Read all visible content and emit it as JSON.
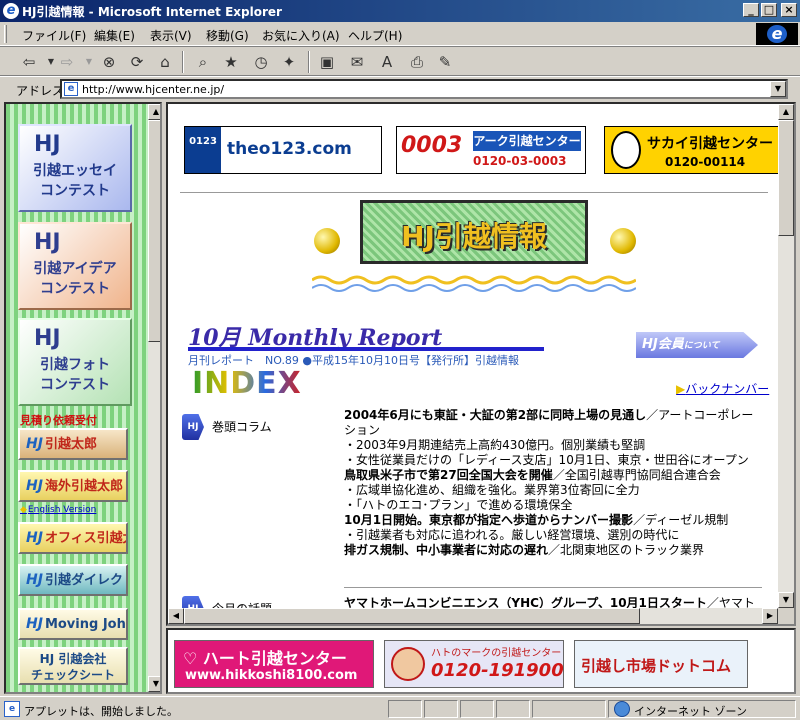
{
  "window": {
    "title": "HJ引越情報 - Microsoft Internet Explorer",
    "controls": {
      "minimize": "_",
      "maximize": "□",
      "close": "×"
    }
  },
  "menu": [
    "ファイル(F)",
    "編集(E)",
    "表示(V)",
    "移動(G)",
    "お気に入り(A)",
    "ヘルプ(H)"
  ],
  "toolbar": {
    "icons": [
      "back-icon",
      "forward-icon",
      "stop-icon",
      "refresh-icon",
      "home-icon",
      "search-icon",
      "favorites-icon",
      "history-icon",
      "channels-icon",
      "fullscreen-icon",
      "mail-icon",
      "font-icon",
      "print-icon",
      "edit-icon"
    ]
  },
  "address": {
    "label": "アドレス",
    "url": "http://www.hjcenter.ne.jp/"
  },
  "left_nav": {
    "tiles": [
      {
        "hj": "HJ",
        "line1": "引越エッセイ",
        "line2": "コンテスト"
      },
      {
        "hj": "HJ",
        "line1": "引越アイデア",
        "line2": "コンテスト"
      },
      {
        "hj": "HJ",
        "line1": "引越フォト",
        "line2": "コンテスト"
      }
    ],
    "estimate_label": "見積り依頼受付",
    "buttons": [
      {
        "hj": "HJ",
        "label": "引越太郎"
      },
      {
        "hj": "HJ",
        "label": "海外引越太郎"
      },
      {
        "hj": "HJ",
        "label": "オフィス引越太郎"
      },
      {
        "hj": "HJ",
        "label": "引越ダイレクト"
      },
      {
        "hj": "HJ",
        "label": "Moving John"
      }
    ],
    "english_link": "English Version",
    "check_sheet": {
      "line1": "HJ 引越会社",
      "line2": "チェックシート"
    }
  },
  "ads_top": [
    {
      "badge": "0123",
      "text": "theo123.com"
    },
    {
      "number": "0003",
      "name": "アーク引越センター",
      "tel": "0120-03-0003"
    },
    {
      "name": "サカイ引越センター",
      "tel": "0120-00114"
    }
  ],
  "header_logo": "HJ引越情報",
  "report": {
    "title": "10月 Monthly Report",
    "subtitle": "月刊レポート　NO.89 ●平成15年10月10日号【発行所】引越情報"
  },
  "member_button": {
    "main": "HJ会員",
    "small": "について"
  },
  "index_title": "INDEX",
  "back_numbers": "バックナンバー",
  "sections": [
    {
      "label": "巻頭コラム",
      "lines": [
        {
          "text": "2004年6月にも東証・大証の第2部に同時上場の見通し",
          "rest": "／アートコーポレーション",
          "bold": true
        },
        {
          "text": "・2003年9月期連結売上高約430億円。個別業績も堅調",
          "bold": false
        },
        {
          "text": "・女性従業員だけの「レディース支店」10月1日、東京・世田谷にオープン",
          "bold": false
        },
        {
          "text": "鳥取県米子市で第27回全国大会を開催",
          "rest": "／全国引越専門協同組合連合会",
          "bold": true
        },
        {
          "text": "・広域単協化進め、組織を強化。業界第3位寄回に全力",
          "bold": false
        },
        {
          "text": "・「ハトのエコ･プラン」で進める環境保全",
          "bold": false
        },
        {
          "text": "10月1日開始。東京都が指定へ歩道からナンバー撮影",
          "rest": "／ディーゼル規制",
          "bold": true
        },
        {
          "text": "・引越業者も対応に追われる。厳しい経営環境、選別の時代に",
          "bold": false
        },
        {
          "text": "排ガス規制、中小事業者に対応の遅れ",
          "rest": "／北関東地区のトラック業界",
          "bold": true
        }
      ]
    },
    {
      "label": "今月の話題",
      "lines": [
        {
          "text": "ヤマトホームコンビニエンス（YHC）グループ、10月1日スタート",
          "rest": "／ヤマト",
          "bold": true
        }
      ]
    }
  ],
  "ads_bottom": [
    {
      "name": "ハート引越センター",
      "url": "www.hikkoshi8100.com"
    },
    {
      "name": "ハトのマークの引越センター",
      "tel": "0120-191900"
    },
    {
      "name": "引越し市場ドットコム"
    }
  ],
  "status": {
    "text": "アプレットは、開始しました。",
    "zone": "インターネット ゾーン"
  },
  "colors": {
    "title_bar": "#0a246a",
    "report_title": "#3a2aa8",
    "link": "#0000cc"
  }
}
